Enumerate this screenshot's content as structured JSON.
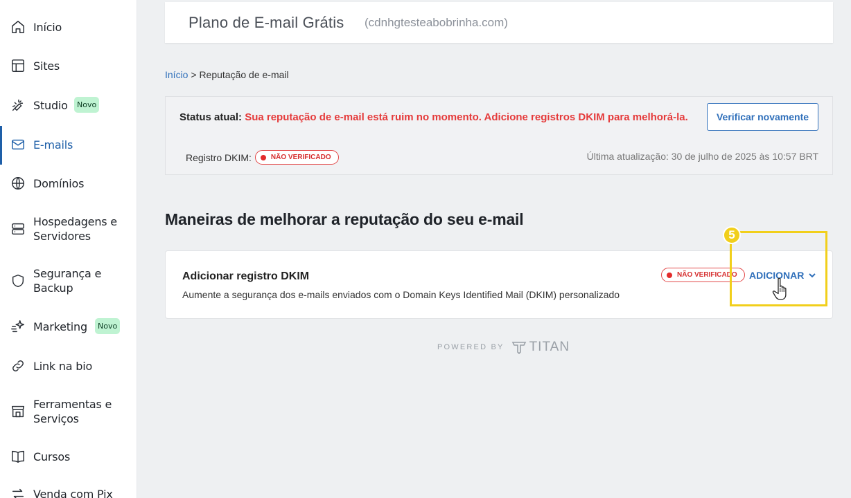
{
  "sidebar": {
    "items": [
      {
        "label": "Início",
        "icon": "home-icon"
      },
      {
        "label": "Sites",
        "icon": "layout-icon"
      },
      {
        "label": "Studio",
        "icon": "magic-wand-icon",
        "badge": "Novo"
      },
      {
        "label": "E-mails",
        "icon": "mail-icon",
        "active": true
      },
      {
        "label": "Domínios",
        "icon": "globe-icon"
      },
      {
        "label": "Hospedagens e Servidores",
        "line1": "Hospedagens e",
        "line2": "Servidores",
        "icon": "server-icon"
      },
      {
        "label": "Segurança e Backup",
        "line1": "Segurança e",
        "line2": "Backup",
        "icon": "shield-icon"
      },
      {
        "label": "Marketing",
        "icon": "sparkle-icon",
        "badge": "Novo"
      },
      {
        "label": "Link na bio",
        "icon": "link-icon"
      },
      {
        "label": "Ferramentas e Serviços",
        "line1": "Ferramentas e",
        "line2": "Serviços",
        "icon": "store-icon"
      },
      {
        "label": "Cursos",
        "icon": "book-icon"
      },
      {
        "label": "Venda com Pix",
        "icon": "arrows-icon"
      }
    ]
  },
  "header": {
    "title": "Plano de E-mail Grátis",
    "domain": "(cdnhgtesteabobrinha.com)"
  },
  "breadcrumb": {
    "home": "Início",
    "separator": ">",
    "current": "Reputação de e-mail"
  },
  "status": {
    "label": "Status atual:",
    "message": "Sua reputação de e-mail está ruim no momento. Adicione registros DKIM para melhorá-la.",
    "verify_button": "Verificar novamente",
    "dkim_label": "Registro DKIM:",
    "dkim_status": "NÃO VERIFICADO",
    "last_update": "Última atualização: 30 de julho de 2025 às 10:57 BRT"
  },
  "section": {
    "title": "Maneiras de melhorar a reputação do seu e-mail"
  },
  "dkim_card": {
    "title": "Adicionar registro DKIM",
    "description": "Aumente a segurança dos e-mails enviados com o Domain Keys Identified Mail (DKIM) personalizado",
    "status": "NÃO VERIFICADO",
    "action": "ADICIONAR"
  },
  "annotation": {
    "step_number": "5"
  },
  "footer": {
    "powered_by": "POWERED BY",
    "brand": "TITAN"
  },
  "colors": {
    "accent": "#2f6fba",
    "danger": "#e53b3b",
    "highlight": "#f1cf1b",
    "badge_bg": "#bff3d2"
  }
}
